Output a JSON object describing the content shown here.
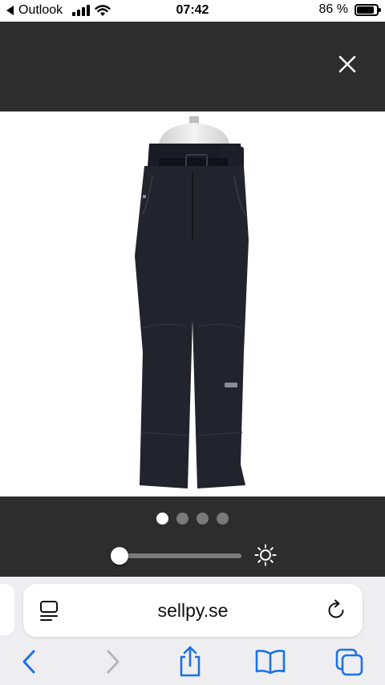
{
  "status_bar": {
    "back_app": "Outlook",
    "time": "07:42",
    "battery_text": "86 %",
    "battery_level": 0.86
  },
  "viewer": {
    "image_count": 4,
    "active_index": 0,
    "brightness_level": 0.02
  },
  "browser": {
    "url": "sellpy.se"
  },
  "colors": {
    "viewer_bg": "#2d2d2d",
    "accent": "#1a73e8",
    "disabled": "#b5b5b5"
  },
  "icons": [
    "close-icon",
    "sun-icon",
    "page-menu-icon",
    "reload-icon",
    "back-icon",
    "forward-icon",
    "share-icon",
    "bookmarks-icon",
    "tabs-icon"
  ]
}
